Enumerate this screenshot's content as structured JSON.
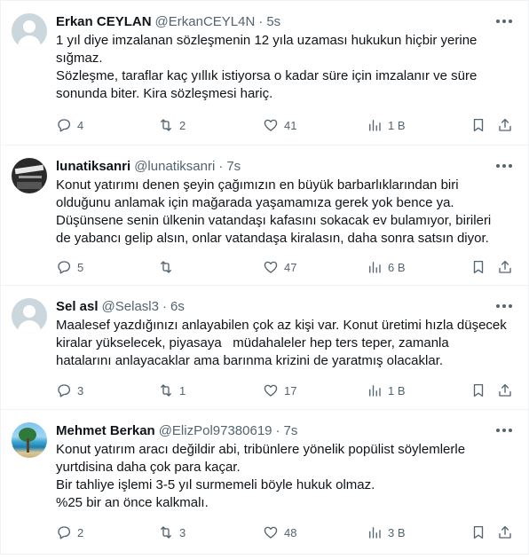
{
  "tweets": [
    {
      "name": "Erkan CEYLAN",
      "handle": "@ErkanCEYL4N",
      "separator": "·",
      "time": "5s",
      "avatar": "default-avatar",
      "lines": [
        "1 yıl diye imzalanan sözleşmenin 12 yıla uzaması hukukun hiçbir yerine",
        "sığmaz.",
        "Sözleşme, taraflar kaç yıllık istiyorsa o kadar süre için imzalanır ve süre",
        "sonunda biter. Kira sözleşmesi hariç."
      ],
      "replies": "4",
      "retweets": "2",
      "likes": "41",
      "views": "1 B"
    },
    {
      "name": "lunatiksanri",
      "handle": "@lunatiksanri",
      "separator": "·",
      "time": "7s",
      "avatar": "dark-photo-avatar",
      "lines": [
        "Konut yatırımı denen şeyin çağımızın en büyük barbarlıklarından biri",
        "olduğunu anlamak için mağarada yaşamamıza gerek yok bence ya.",
        "Düşünsene senin ülkenin vatandaşı kafasını sokacak ev bulamıyor, birileri",
        "de yabancı gelip alsın, onlar vatandaşa kiralasın, daha sonra satsın diyor."
      ],
      "replies": "5",
      "retweets": "",
      "likes": "47",
      "views": "6 B"
    },
    {
      "name": "Sel asl",
      "handle": "@Selasl3",
      "separator": "·",
      "time": "6s",
      "avatar": "default-avatar",
      "lines": [
        "Maalesef yazdığınızı anlayabilen çok az kişi var. Konut üretimi hızla düşecek",
        "kiralar yükselecek, piyasaya   müdahaleler hep ters teper, zamanla",
        "hatalarını anlayacaklar ama barınma krizini de yaratmış olacaklar."
      ],
      "replies": "3",
      "retweets": "1",
      "likes": "17",
      "views": "1 B"
    },
    {
      "name": "Mehmet Berkan",
      "handle": "@ElizPol97380619",
      "separator": "·",
      "time": "7s",
      "avatar": "beach-photo-avatar",
      "lines": [
        "Konut yatırım aracı değildir abi, tribünlere yönelik popülist söylemlerle",
        "yurtdisina daha çok para kaçar.",
        "Bir tahliye işlemi 3-5 yıl surmemeli böyle hukuk olmaz.",
        "%25 bir an önce kalkmalı."
      ],
      "replies": "2",
      "retweets": "3",
      "likes": "48",
      "views": "3 B"
    }
  ],
  "icons": {
    "reply": "reply-icon",
    "retweet": "retweet-icon",
    "like": "like-icon",
    "views": "views-icon",
    "bookmark": "bookmark-icon",
    "share": "share-icon",
    "more": "more-icon"
  },
  "colors": {
    "text": "#0f1419",
    "secondary": "#536471",
    "border": "#eff3f4"
  }
}
